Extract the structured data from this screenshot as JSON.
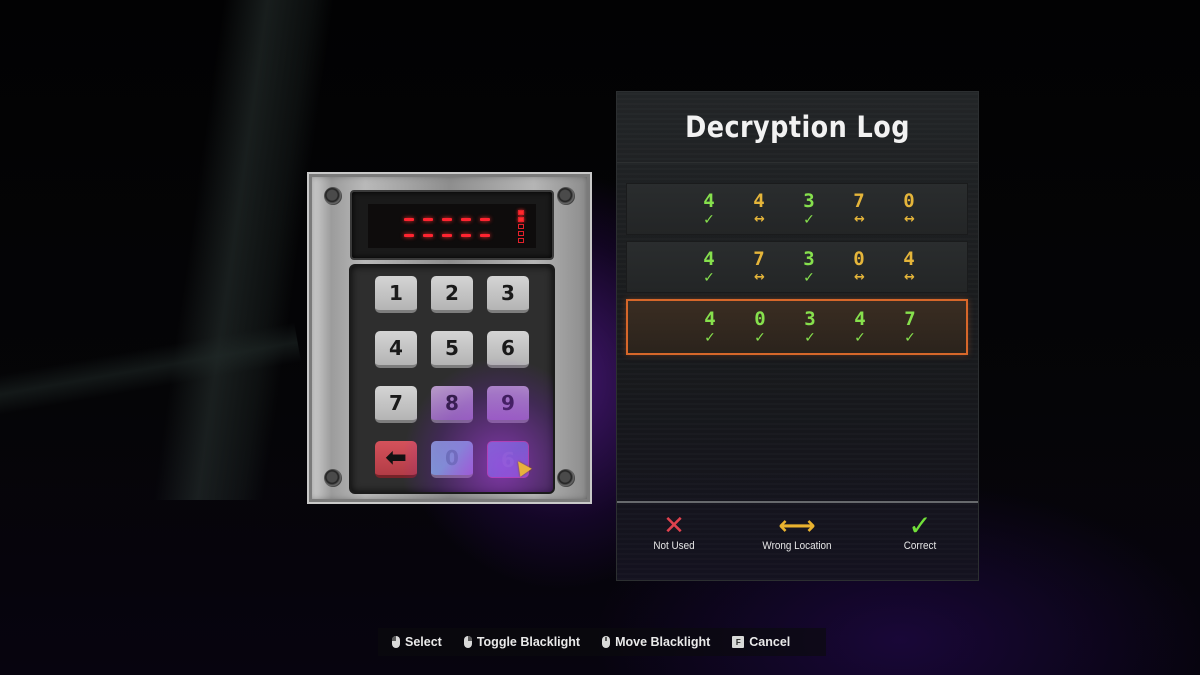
{
  "keypad": {
    "display": {
      "row1": [
        "-",
        "-",
        "-",
        "-",
        "-"
      ],
      "row2": [
        "-",
        "-",
        "-",
        "-",
        "-"
      ],
      "attempts_total": 5,
      "attempts_used": 2
    },
    "keys": [
      {
        "label": "1",
        "style": "normal"
      },
      {
        "label": "2",
        "style": "normal"
      },
      {
        "label": "3",
        "style": "normal"
      },
      {
        "label": "4",
        "style": "normal"
      },
      {
        "label": "5",
        "style": "normal"
      },
      {
        "label": "6",
        "style": "normal"
      },
      {
        "label": "7",
        "style": "normal"
      },
      {
        "label": "8",
        "style": "purple"
      },
      {
        "label": "9",
        "style": "purple"
      },
      {
        "label": "⬅",
        "style": "back",
        "name": "backspace"
      },
      {
        "label": "0",
        "style": "glow0"
      },
      {
        "label": "6",
        "style": "glow6"
      }
    ]
  },
  "log": {
    "title": "Decryption Log",
    "rows": [
      {
        "current": false,
        "cells": [
          {
            "digit": "4",
            "status": "correct"
          },
          {
            "digit": "4",
            "status": "wrong"
          },
          {
            "digit": "3",
            "status": "correct"
          },
          {
            "digit": "7",
            "status": "wrong"
          },
          {
            "digit": "0",
            "status": "wrong"
          }
        ]
      },
      {
        "current": false,
        "cells": [
          {
            "digit": "4",
            "status": "correct"
          },
          {
            "digit": "7",
            "status": "wrong"
          },
          {
            "digit": "3",
            "status": "correct"
          },
          {
            "digit": "0",
            "status": "wrong"
          },
          {
            "digit": "4",
            "status": "wrong"
          }
        ]
      },
      {
        "current": true,
        "cells": [
          {
            "digit": "4",
            "status": "correct"
          },
          {
            "digit": "0",
            "status": "correct"
          },
          {
            "digit": "3",
            "status": "correct"
          },
          {
            "digit": "4",
            "status": "correct"
          },
          {
            "digit": "7",
            "status": "correct"
          }
        ]
      }
    ],
    "marks": {
      "correct": "✓",
      "wrong": "↔",
      "notused": "✕"
    },
    "legend": {
      "not_used": {
        "icon": "✕",
        "label": "Not Used"
      },
      "wrong_location": {
        "icon": "⟷",
        "label": "Wrong Location"
      },
      "correct": {
        "icon": "✓",
        "label": "Correct"
      }
    },
    "colors": {
      "correct": "#86e04d",
      "wrong": "#e5b53a",
      "not_used": "#e0424e",
      "highlight": "#d7672a"
    }
  },
  "hints": [
    {
      "icon": "mouse-left",
      "label": "Select"
    },
    {
      "icon": "mouse-right",
      "label": "Toggle Blacklight"
    },
    {
      "icon": "mouse-middle",
      "label": "Move Blacklight"
    },
    {
      "icon": "key-f",
      "key": "F",
      "label": "Cancel"
    }
  ]
}
